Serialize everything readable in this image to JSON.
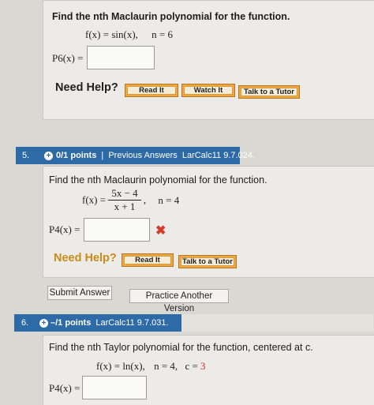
{
  "q4": {
    "prompt": "Find the nth Maclaurin polynomial for the function.",
    "function": "f(x) = sin(x),",
    "n": "n = 6",
    "answer_label": "P6(x) =",
    "answer_value": "",
    "help_label": "Need Help?",
    "buttons": [
      "Read It",
      "Watch It",
      "Talk to a Tutor"
    ]
  },
  "q5": {
    "number": "5.",
    "points": "0/1 points",
    "sep": "|",
    "previous_answers": "Previous Answers",
    "ref": "LarCalc11 9.7.024.",
    "prompt": "Find the nth Maclaurin polynomial for the function.",
    "f_label": "f(x) =",
    "numerator": "5x − 4",
    "denominator": "x + 1",
    "comma": ",",
    "n": "n = 4",
    "answer_label": "P4(x) =",
    "answer_value": "",
    "wrong_mark": "✖",
    "help_label": "Need Help?",
    "buttons": [
      "Read It",
      "Talk to a Tutor"
    ],
    "submit": "Submit Answer",
    "practice": "Practice Another Version"
  },
  "q6": {
    "number": "6.",
    "points": "–/1 points",
    "ref": "LarCalc11 9.7.031.",
    "prompt": "Find the nth Taylor polynomial for the function, centered at c.",
    "function": "f(x) = ln(x),",
    "n": "n = 4,",
    "c_label": "c =",
    "c_value": "3",
    "answer_label": "P4(x) =",
    "answer_value": ""
  },
  "colors": {
    "header": "#2d6aa6",
    "accent": "#f0a83e",
    "wrong": "#d33b2c",
    "c_value": "#d9302a"
  }
}
